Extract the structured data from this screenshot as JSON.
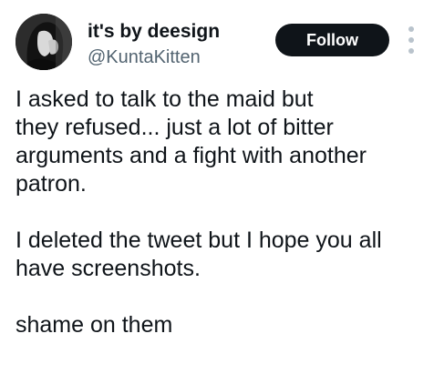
{
  "user": {
    "display_name": "it's by deesign",
    "handle": "@KuntaKitten",
    "avatar_icon": "profile-photo"
  },
  "actions": {
    "follow_label": "Follow",
    "more_icon": "vertical-ellipsis-icon"
  },
  "tweet": {
    "paragraph_1": "I asked to talk to the maid but\nthey refused... just a lot of bitter\narguments and a fight with another\npatron.",
    "paragraph_2": "I deleted the tweet but I hope you all\nhave screenshots.",
    "paragraph_3": "shame on them"
  },
  "colors": {
    "text": "#0f1419",
    "handle": "#536471",
    "follow_bg": "#0f1419",
    "follow_text": "#ffffff",
    "more_dots": "#b9c3cc"
  }
}
